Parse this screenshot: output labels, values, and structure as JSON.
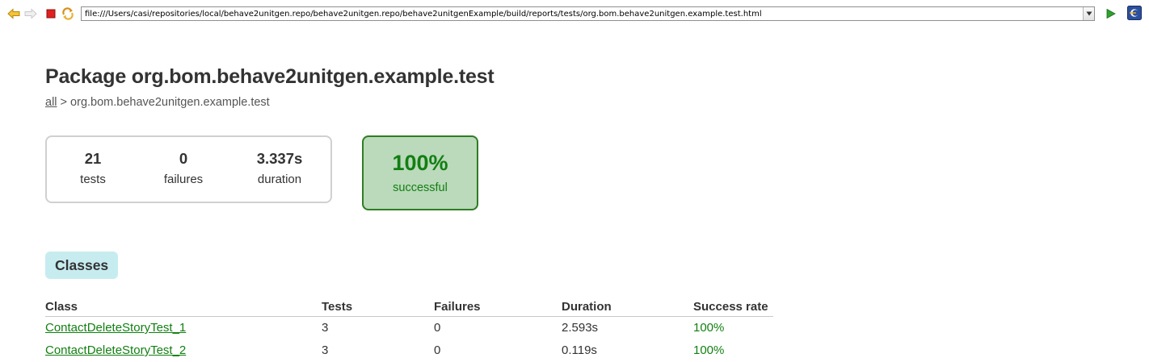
{
  "browser": {
    "url": "file:///Users/casi/repositories/local/behave2unitgen.repo/behave2unitgen.repo/behave2unitgenExample/build/reports/tests/org.bom.behave2unitgen.example.test.html",
    "icons": {
      "back": "back-arrow-icon",
      "forward": "forward-arrow-icon",
      "stop": "stop-icon",
      "refresh": "refresh-icon",
      "dropdown": "chevron-down-icon",
      "go": "go-play-icon",
      "eclipse": "eclipse-browser-icon"
    }
  },
  "page": {
    "title": "Package org.bom.behave2unitgen.example.test",
    "breadcrumb": {
      "root_link": "all",
      "separator": " > ",
      "current": "org.bom.behave2unitgen.example.test"
    }
  },
  "summary": {
    "tests": {
      "value": "21",
      "label": "tests"
    },
    "failures": {
      "value": "0",
      "label": "failures"
    },
    "duration": {
      "value": "3.337s",
      "label": "duration"
    },
    "success": {
      "value": "100%",
      "label": "successful"
    }
  },
  "classes_tab": {
    "label": "Classes"
  },
  "classes_table": {
    "headers": {
      "class": "Class",
      "tests": "Tests",
      "failures": "Failures",
      "duration": "Duration",
      "success_rate": "Success rate"
    },
    "rows": [
      {
        "class": "ContactDeleteStoryTest_1",
        "tests": "3",
        "failures": "0",
        "duration": "2.593s",
        "success_rate": "100%"
      },
      {
        "class": "ContactDeleteStoryTest_2",
        "tests": "3",
        "failures": "0",
        "duration": "0.119s",
        "success_rate": "100%"
      }
    ]
  },
  "colors": {
    "success_green": "#127f12",
    "success_bg": "#bbd9bb",
    "tab_bg": "#c7ecf0",
    "text": "#333333"
  }
}
